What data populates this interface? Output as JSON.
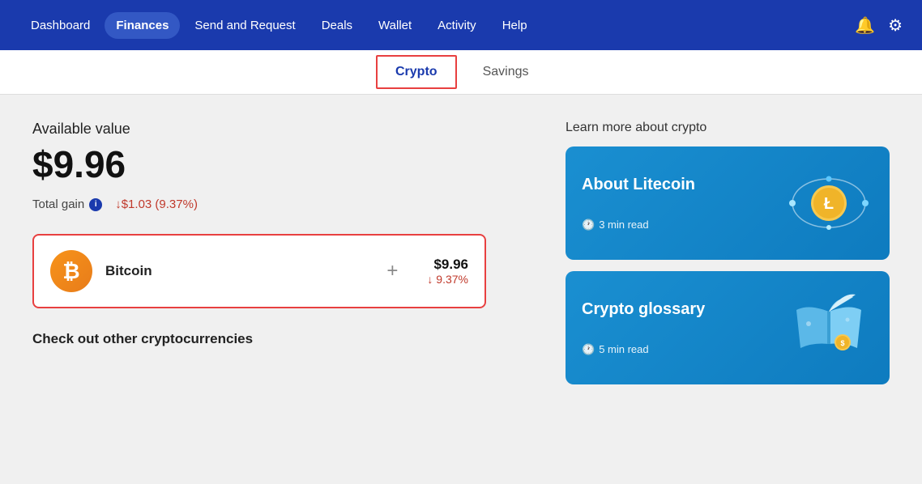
{
  "nav": {
    "items": [
      {
        "id": "dashboard",
        "label": "Dashboard",
        "active": false
      },
      {
        "id": "finances",
        "label": "Finances",
        "active": true
      },
      {
        "id": "send-request",
        "label": "Send and Request",
        "active": false
      },
      {
        "id": "deals",
        "label": "Deals",
        "active": false
      },
      {
        "id": "wallet",
        "label": "Wallet",
        "active": false
      },
      {
        "id": "activity",
        "label": "Activity",
        "active": false
      },
      {
        "id": "help",
        "label": "Help",
        "active": false
      }
    ]
  },
  "tabs": [
    {
      "id": "crypto",
      "label": "Crypto",
      "active": true
    },
    {
      "id": "savings",
      "label": "Savings",
      "active": false
    }
  ],
  "main": {
    "available_label": "Available value",
    "available_value": "$9.96",
    "total_gain_label": "Total gain",
    "total_gain_value": "↓$1.03 (9.37%)",
    "crypto_name": "Bitcoin",
    "crypto_usd": "$9.96",
    "crypto_pct": "↓ 9.37%",
    "check_other": "Check out other cryptocurrencies"
  },
  "learn": {
    "title": "Learn more about crypto",
    "cards": [
      {
        "id": "litecoin",
        "title": "About Litecoin",
        "read_time": "3 min read"
      },
      {
        "id": "glossary",
        "title": "Crypto glossary",
        "read_time": "5 min read"
      }
    ]
  }
}
